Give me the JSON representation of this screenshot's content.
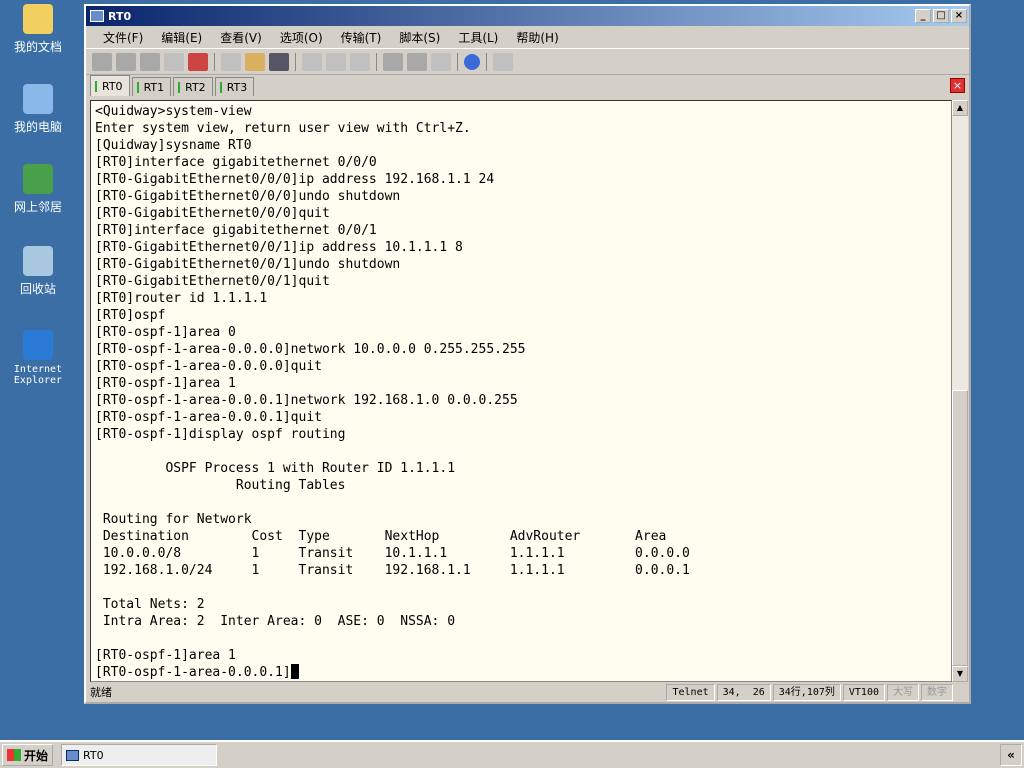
{
  "desktop": {
    "icons": [
      {
        "label": "我的文档",
        "color": "#f2d060"
      },
      {
        "label": "我的电脑",
        "color": "#8ab8e8"
      },
      {
        "label": "网上邻居",
        "color": "#4aa04a"
      },
      {
        "label": "回收站",
        "color": "#a8c8e0"
      },
      {
        "label": "Internet Explorer",
        "color": "#2a7ad8"
      }
    ]
  },
  "window": {
    "title": "RT0",
    "menu": [
      "文件(F)",
      "编辑(E)",
      "查看(V)",
      "选项(O)",
      "传输(T)",
      "脚本(S)",
      "工具(L)",
      "帮助(H)"
    ],
    "tabs": [
      "RT0",
      "RT1",
      "RT2",
      "RT3"
    ],
    "terminal": {
      "lines": [
        "<Quidway>system-view",
        "Enter system view, return user view with Ctrl+Z.",
        "[Quidway]sysname RT0",
        "[RT0]interface gigabitethernet 0/0/0",
        "[RT0-GigabitEthernet0/0/0]ip address 192.168.1.1 24",
        "[RT0-GigabitEthernet0/0/0]undo shutdown",
        "[RT0-GigabitEthernet0/0/0]quit",
        "[RT0]interface gigabitethernet 0/0/1",
        "[RT0-GigabitEthernet0/0/1]ip address 10.1.1.1 8",
        "[RT0-GigabitEthernet0/0/1]undo shutdown",
        "[RT0-GigabitEthernet0/0/1]quit",
        "[RT0]router id 1.1.1.1",
        "[RT0]ospf",
        "[RT0-ospf-1]area 0",
        "[RT0-ospf-1-area-0.0.0.0]network 10.0.0.0 0.255.255.255",
        "[RT0-ospf-1-area-0.0.0.0]quit",
        "[RT0-ospf-1]area 1",
        "[RT0-ospf-1-area-0.0.0.1]network 192.168.1.0 0.0.0.255",
        "[RT0-ospf-1-area-0.0.0.1]quit",
        "[RT0-ospf-1]display ospf routing",
        "",
        "         OSPF Process 1 with Router ID 1.1.1.1",
        "                  Routing Tables",
        "",
        " Routing for Network",
        " Destination        Cost  Type       NextHop         AdvRouter       Area",
        " 10.0.0.0/8         1     Transit    10.1.1.1        1.1.1.1         0.0.0.0",
        " 192.168.1.0/24     1     Transit    192.168.1.1     1.1.1.1         0.0.0.1",
        "",
        " Total Nets: 2",
        " Intra Area: 2  Inter Area: 0  ASE: 0  NSSA: 0",
        "",
        "[RT0-ospf-1]area 1",
        "[RT0-ospf-1-area-0.0.0.1]"
      ]
    },
    "status": {
      "ready": "就绪",
      "protocol": "Telnet",
      "cursor": "34,  26",
      "size": "34行,107列",
      "emulation": "VT100",
      "caps": "大写",
      "num": "数字"
    }
  },
  "taskbar": {
    "start": "开始",
    "task": "RT0",
    "tray_toggle": "«"
  }
}
